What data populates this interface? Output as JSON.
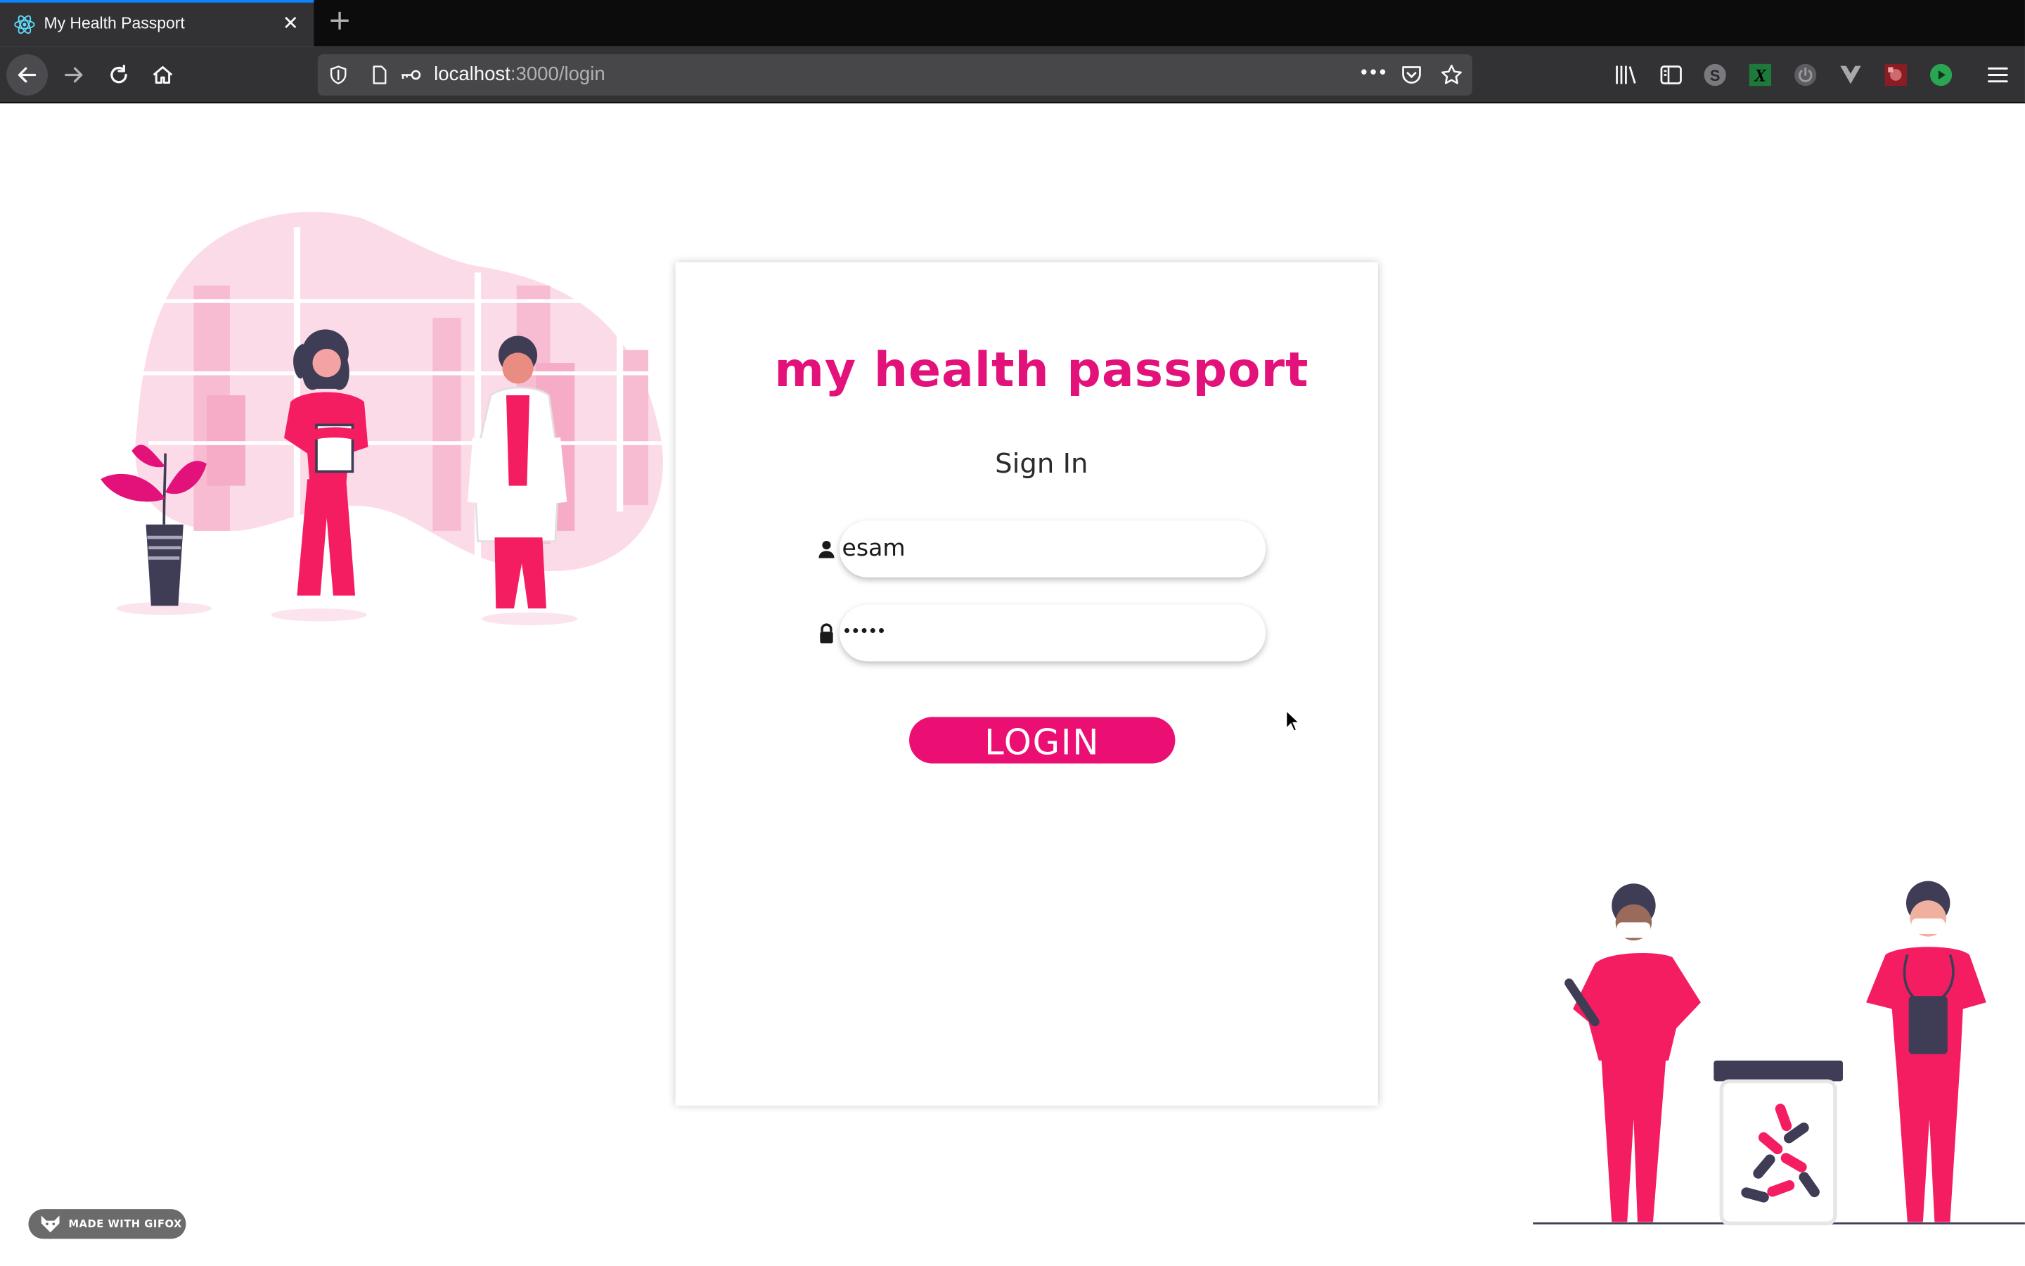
{
  "browser": {
    "tab_title": "My Health Passport",
    "tab_close": "✕",
    "new_tab": "+",
    "url_host": "localhost",
    "url_path": ":3000/login",
    "page_actions": "•••",
    "accent_color": "#0a84ff"
  },
  "login": {
    "brand": "my health passport",
    "heading": "Sign In",
    "username_value": "esam",
    "password_value": "•••••",
    "button_label": "LOGIN",
    "brand_color": "#e2127a",
    "button_color": "#ec0f73"
  },
  "badge": {
    "label": "MADE WITH GIFOX"
  },
  "icons": {
    "tab": "react-logo-icon",
    "user": "user-icon",
    "lock": "lock-icon"
  }
}
